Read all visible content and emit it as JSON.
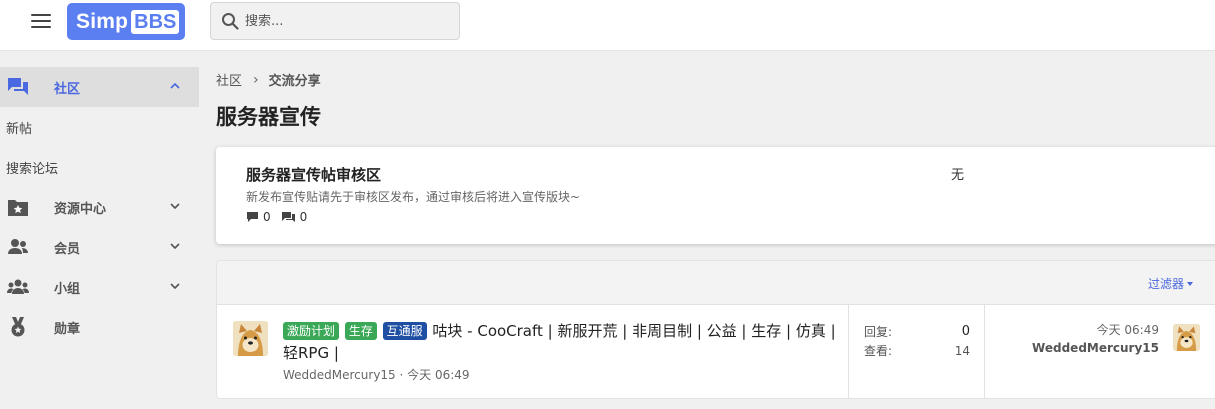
{
  "header": {
    "logo_part1": "Simp",
    "logo_part2": "BBS",
    "search_placeholder": "搜索..."
  },
  "sidebar": {
    "items": [
      {
        "label": "社区",
        "icon": "forum-icon",
        "active": true,
        "expanded": true
      },
      {
        "label": "新帖",
        "sub": true
      },
      {
        "label": "搜索论坛",
        "sub": true
      },
      {
        "label": "资源中心",
        "icon": "resources-icon"
      },
      {
        "label": "会员",
        "icon": "members-icon"
      },
      {
        "label": "小组",
        "icon": "groups-icon"
      },
      {
        "label": "勋章",
        "icon": "medal-icon"
      }
    ]
  },
  "breadcrumb": {
    "root": "社区",
    "current": "交流分享"
  },
  "page_title": "服务器宣传",
  "subforum": {
    "title": "服务器宣传帖审核区",
    "description": "新发布宣传贴请先于审核区发布，通过审核后将进入宣传版块~",
    "threads": "0",
    "posts": "0",
    "last_post": "无"
  },
  "list": {
    "filter_label": "过滤器"
  },
  "thread": {
    "tags": [
      {
        "label": "激励计划",
        "color": "#3aa857"
      },
      {
        "label": "生存",
        "color": "#3aa857"
      },
      {
        "label": "互通服",
        "color": "#1e4fa3"
      }
    ],
    "title": "咕块 - CooCraft | 新服开荒 | 非周目制 | 公益 | 生存 | 仿真 | 轻RPG |",
    "author": "WeddedMercury15",
    "meta_sep": " · ",
    "time": "今天 06:49",
    "replies_label": "回复:",
    "replies": "0",
    "views_label": "查看:",
    "views": "14",
    "last_time": "今天 06:49",
    "last_user": "WeddedMercury15"
  },
  "colors": {
    "accent": "#4a68df",
    "logo": "#5b7ef0"
  }
}
